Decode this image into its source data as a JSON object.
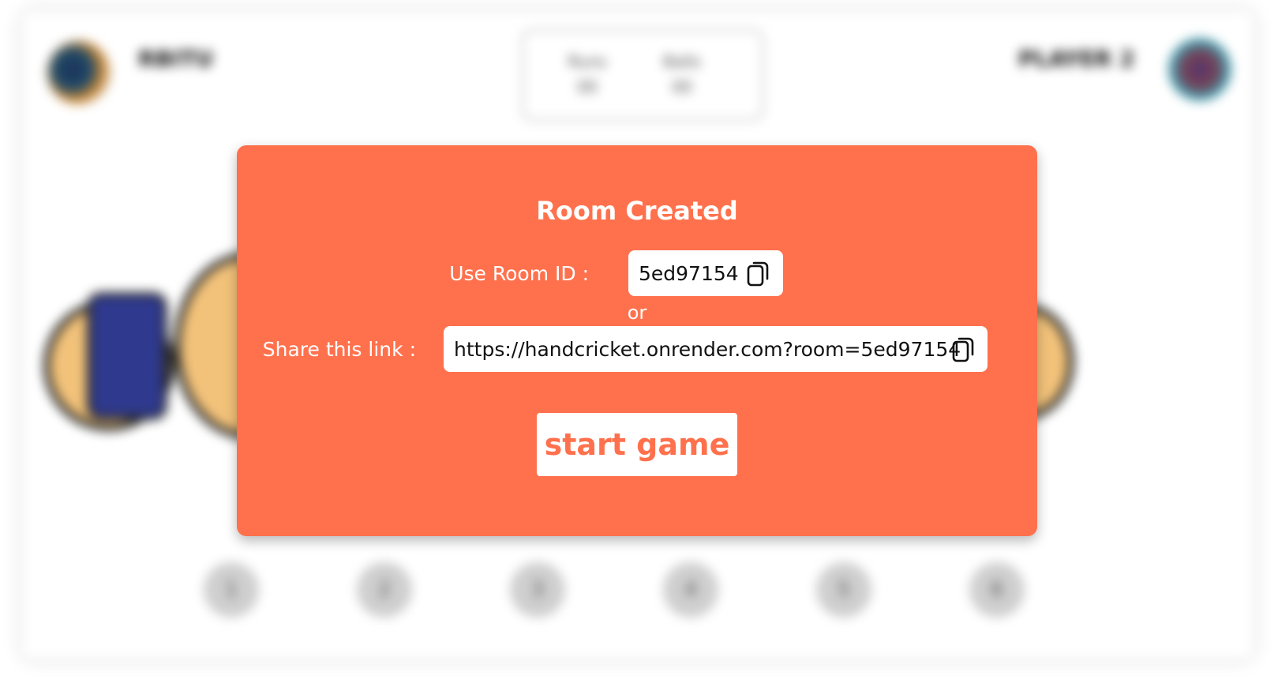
{
  "background": {
    "player_left": "RBITU",
    "player_right": "PLAYER 2",
    "score_left_label": "Runs",
    "score_left_value": "00",
    "score_right_label": "Balls",
    "score_right_value": "00",
    "number_buttons": [
      "1",
      "2",
      "3",
      "4",
      "5",
      "6"
    ]
  },
  "modal": {
    "title": "Room Created",
    "room_label": "Use Room ID :",
    "room_id": "5ed97154",
    "or_text": "or",
    "link_label": "Share this link :",
    "share_link": "https://handcricket.onrender.com?room=5ed97154",
    "start_button": "start game",
    "copy_icon": "copy-icon"
  },
  "colors": {
    "modal_bg": "#ff714d",
    "field_bg": "#ffffff",
    "text_on_modal": "#ffffff",
    "button_text": "#ff714d"
  }
}
